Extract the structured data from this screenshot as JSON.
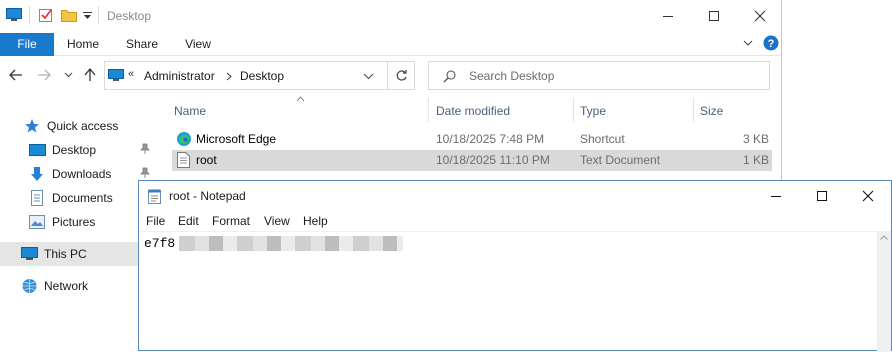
{
  "explorer": {
    "title": "Desktop",
    "tabs": [
      {
        "label": "File"
      },
      {
        "label": "Home"
      },
      {
        "label": "Share"
      },
      {
        "label": "View"
      }
    ],
    "address": {
      "chevron": "«",
      "segments": [
        "Administrator",
        "Desktop"
      ]
    },
    "search": {
      "placeholder": "Search Desktop"
    },
    "sidebar": {
      "items": [
        {
          "label": "Quick access",
          "icon": "star-icon"
        },
        {
          "label": "Desktop",
          "icon": "desktop-folder-icon"
        },
        {
          "label": "Downloads",
          "icon": "download-icon"
        },
        {
          "label": "Documents",
          "icon": "documents-icon"
        },
        {
          "label": "Pictures",
          "icon": "pictures-icon"
        },
        {
          "label": "This PC",
          "icon": "pc-icon"
        },
        {
          "label": "Network",
          "icon": "network-icon"
        }
      ]
    },
    "columns": {
      "name": "Name",
      "date": "Date modified",
      "type": "Type",
      "size": "Size"
    },
    "files": [
      {
        "name": "Microsoft Edge",
        "date": "10/18/2025 7:48 PM",
        "type": "Shortcut",
        "size": "3 KB",
        "icon": "edge-icon"
      },
      {
        "name": "root",
        "date": "10/18/2025 11:10 PM",
        "type": "Text Document",
        "size": "1 KB",
        "icon": "text-file-icon"
      }
    ]
  },
  "notepad": {
    "title": "root - Notepad",
    "menu": [
      "File",
      "Edit",
      "Format",
      "View",
      "Help"
    ],
    "content_visible": "e7f8"
  },
  "colors": {
    "accent": "#1979ca",
    "selection": "#d9d9d9",
    "header_text": "#4c607a"
  }
}
